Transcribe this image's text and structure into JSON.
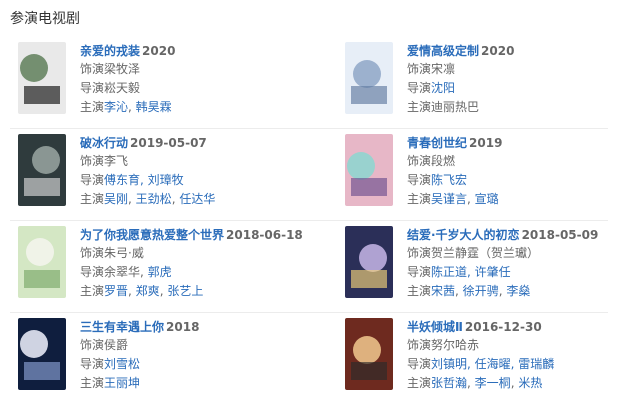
{
  "section": {
    "title": "参演电视剧"
  },
  "works": [
    {
      "title": "亲爱的戎装",
      "year": "2020",
      "role_prefix": "饰演",
      "role": "梁牧泽",
      "director_prefix": "导演",
      "director_name": "",
      "director_static": "崧天毅",
      "actors_prefix": "主演",
      "actor_static": "",
      "actors": [
        "李沁",
        "韩昊霖"
      ],
      "poster": {
        "bg": "#e9e9e9",
        "fg": "#5f7f5a",
        "accent": "#111111"
      }
    },
    {
      "title": "爱情高级定制",
      "year": "2020",
      "role_prefix": "饰演",
      "role": "宋凛",
      "director_prefix": "导演",
      "director_name": "沈阳",
      "director_static": "",
      "actors_prefix": "主演",
      "actor_static": "迪丽热巴",
      "actors": [],
      "poster": {
        "bg": "#e7eef7",
        "fg": "#8ea6c7",
        "accent": "#5f7aa0"
      }
    },
    {
      "title": "破冰行动",
      "year": "2019-05-07",
      "role_prefix": "饰演",
      "role": "李飞",
      "director_prefix": "导演",
      "director_name": "傅东育, 刘璋牧",
      "director_static": "",
      "actors_prefix": "主演",
      "actor_static": "",
      "actors": [
        "吴刚",
        "王劲松",
        "任达华"
      ],
      "poster": {
        "bg": "#2f3b3d",
        "fg": "#9aa7a2",
        "accent": "#d9d9d9"
      }
    },
    {
      "title": "青春创世纪",
      "year": "2019",
      "role_prefix": "饰演",
      "role": "段燃",
      "director_prefix": "导演",
      "director_name": "陈飞宏",
      "director_static": "",
      "actors_prefix": "主演",
      "actor_static": "",
      "actors": [
        "吴谨言",
        "宣璐"
      ],
      "poster": {
        "bg": "#e7b7c7",
        "fg": "#8bd7d0",
        "accent": "#6c4f8f"
      }
    },
    {
      "title": "为了你我愿意热爱整个世界",
      "year": "2018-06-18",
      "role_prefix": "饰演",
      "role": "朱弓·威",
      "director_prefix": "导演",
      "director_static": "余翠华, ",
      "director_name": "郭虎",
      "actors_prefix": "主演",
      "actor_static": "",
      "actors": [
        "罗晋",
        "郑爽",
        "张艺上"
      ],
      "poster": {
        "bg": "#d4e7c4",
        "fg": "#f5f5ef",
        "accent": "#7aa768"
      }
    },
    {
      "title": "结爱·千岁大人的初恋",
      "year": "2018-05-09",
      "role_prefix": "饰演",
      "role": "贺兰静霆（贺兰瓛）",
      "director_prefix": "导演",
      "director_name": "陈正道, 许肇任",
      "director_static": "",
      "actors_prefix": "主演",
      "actor_static": "",
      "actors": [
        "宋茜",
        "徐开骋",
        "李燊"
      ],
      "poster": {
        "bg": "#2b2f58",
        "fg": "#c7b6e8",
        "accent": "#f2d37a"
      }
    },
    {
      "title": "三生有幸遇上你",
      "year": "2018",
      "role_prefix": "饰演",
      "role": "侯爵",
      "director_prefix": "导演",
      "director_name": "刘雪松",
      "director_static": "",
      "actors_prefix": "主演",
      "actor_static": "",
      "actors": [
        "王丽坤"
      ],
      "poster": {
        "bg": "#0f1e3e",
        "fg": "#f1f3ff",
        "accent": "#8aa2d6"
      }
    },
    {
      "title": "半妖倾城Ⅱ",
      "year": "2016-12-30",
      "role_prefix": "饰演",
      "role": "努尔哈赤",
      "director_prefix": "导演",
      "director_name": "刘镇明, 任海曜, 雷瑞麟",
      "director_static": "",
      "actors_prefix": "主演",
      "actor_static": "",
      "actors": [
        "张哲瀚",
        "李一桐",
        "米热"
      ],
      "poster": {
        "bg": "#6e2a1f",
        "fg": "#f2c98f",
        "accent": "#2b2b2b"
      }
    }
  ]
}
